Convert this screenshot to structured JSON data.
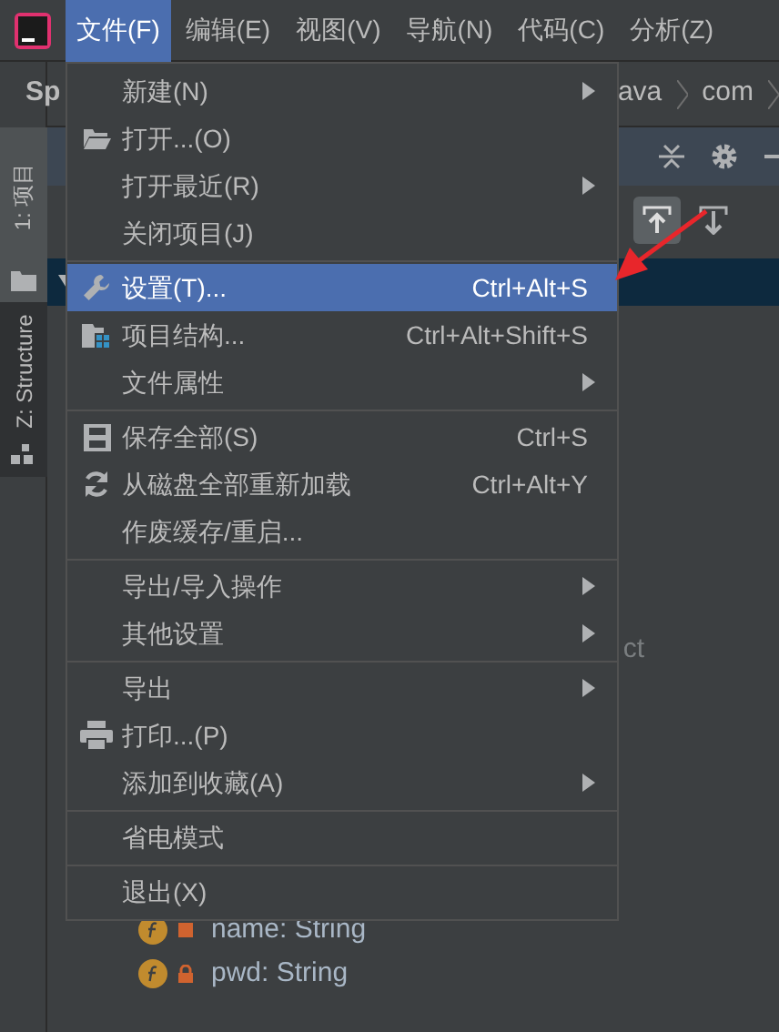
{
  "menu_bar": [
    {
      "label": "文件(F)",
      "selected": true
    },
    {
      "label": "编辑(E)",
      "selected": false
    },
    {
      "label": "视图(V)",
      "selected": false
    },
    {
      "label": "导航(N)",
      "selected": false
    },
    {
      "label": "代码(C)",
      "selected": false
    },
    {
      "label": "分析(Z)",
      "selected": false
    }
  ],
  "breadcrumb": [
    "Sp",
    "ava",
    "com"
  ],
  "tool_stripe": [
    {
      "label": "1: 项目",
      "selected": true
    },
    {
      "label": "Z: Structure",
      "selected": false
    }
  ],
  "tree": {
    "partial_text": "ct",
    "items": [
      {
        "label": "name: String"
      },
      {
        "label": "pwd: String"
      }
    ]
  },
  "file_menu": [
    {
      "kind": "item",
      "label": "新建(N)",
      "submenu": true,
      "selected": false
    },
    {
      "kind": "item",
      "label": "打开...(O)",
      "submenu": false,
      "selected": false
    },
    {
      "kind": "item",
      "label": "打开最近(R)",
      "submenu": true,
      "selected": false
    },
    {
      "kind": "item",
      "label": "关闭项目(J)",
      "submenu": false,
      "selected": false
    },
    {
      "kind": "separator"
    },
    {
      "kind": "item",
      "label": "设置(T)...",
      "shortcut": "Ctrl+Alt+S",
      "submenu": false,
      "selected": true
    },
    {
      "kind": "item",
      "label": "项目结构...",
      "shortcut": "Ctrl+Alt+Shift+S",
      "submenu": false,
      "selected": false
    },
    {
      "kind": "item",
      "label": "文件属性",
      "submenu": true,
      "selected": false
    },
    {
      "kind": "separator"
    },
    {
      "kind": "item",
      "label": "保存全部(S)",
      "shortcut": "Ctrl+S",
      "submenu": false,
      "selected": false
    },
    {
      "kind": "item",
      "label": "从磁盘全部重新加载",
      "shortcut": "Ctrl+Alt+Y",
      "submenu": false,
      "selected": false
    },
    {
      "kind": "item",
      "label": "作废缓存/重启...",
      "submenu": false,
      "selected": false
    },
    {
      "kind": "separator"
    },
    {
      "kind": "item",
      "label": "导出/导入操作",
      "submenu": true,
      "selected": false
    },
    {
      "kind": "item",
      "label": "其他设置",
      "submenu": true,
      "selected": false
    },
    {
      "kind": "separator"
    },
    {
      "kind": "item",
      "label": "导出",
      "submenu": true,
      "selected": false
    },
    {
      "kind": "item",
      "label": "打印...(P)",
      "submenu": false,
      "selected": false
    },
    {
      "kind": "item",
      "label": "添加到收藏(A)",
      "submenu": true,
      "selected": false
    },
    {
      "kind": "separator"
    },
    {
      "kind": "item",
      "label": "省电模式",
      "submenu": false,
      "selected": false
    },
    {
      "kind": "separator"
    },
    {
      "kind": "item",
      "label": "退出(X)",
      "submenu": false,
      "selected": false
    }
  ]
}
